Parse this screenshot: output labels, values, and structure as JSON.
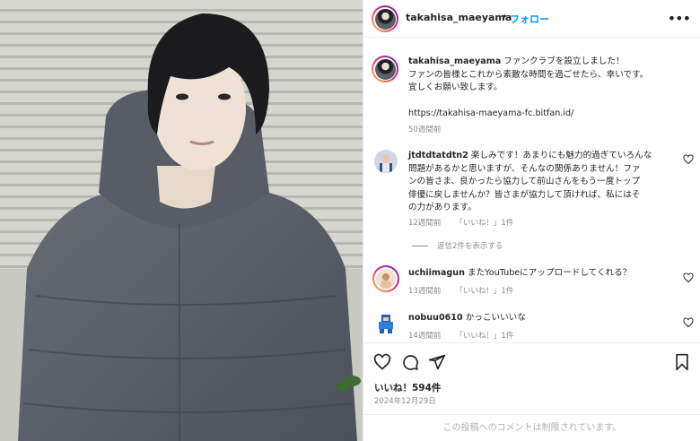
{
  "post": {
    "username": "takahisa_maeyama",
    "separator": "•",
    "follow_label": "フォロー",
    "more_label": "•••",
    "caption_line1": "ファンクラブを設立しました！",
    "caption_line2": "ファンの皆様とこれから素敵な時間を過ごせたら、幸いです。",
    "caption_line3": "宜しくお願い致します。",
    "caption_link": "https://takahisa-maeyama-fc.bitfan.id/",
    "caption_age": "50週間前"
  },
  "comments": [
    {
      "username": "jtdtdtatdtn2",
      "line1": "楽しみです！あまりにも魅力的過ぎていろんな",
      "line2": "問題があるかと思いますが、そんなの関係ありません！ファ",
      "line3": "ンの皆さま、良かったら協力して前山さんをもう一度トップ",
      "line4": "俳優に戻しませんか？皆さまが協力して頂ければ、私にはそ",
      "line5": "の力があります。",
      "age": "12週間前",
      "likes": "「いいね！」1件"
    },
    {
      "username": "uchiimagun",
      "text": "またYouTubeにアップロードしてくれる？",
      "age": "13週間前",
      "likes": "「いいね！」1件"
    },
    {
      "username": "nobuu0610",
      "text": "かっこいいいな",
      "age": "14週間前",
      "likes": "「いいね！」1件"
    }
  ],
  "replies_label": "返信2件を表示する",
  "likes_count": "いいね！594件",
  "post_date": "2024年12月29日",
  "comments_restricted": "この投稿へのコメントは制限されています。",
  "colors": {
    "link_blue": "#0095f6",
    "muted": "#8e8e8e",
    "text": "#262626"
  }
}
